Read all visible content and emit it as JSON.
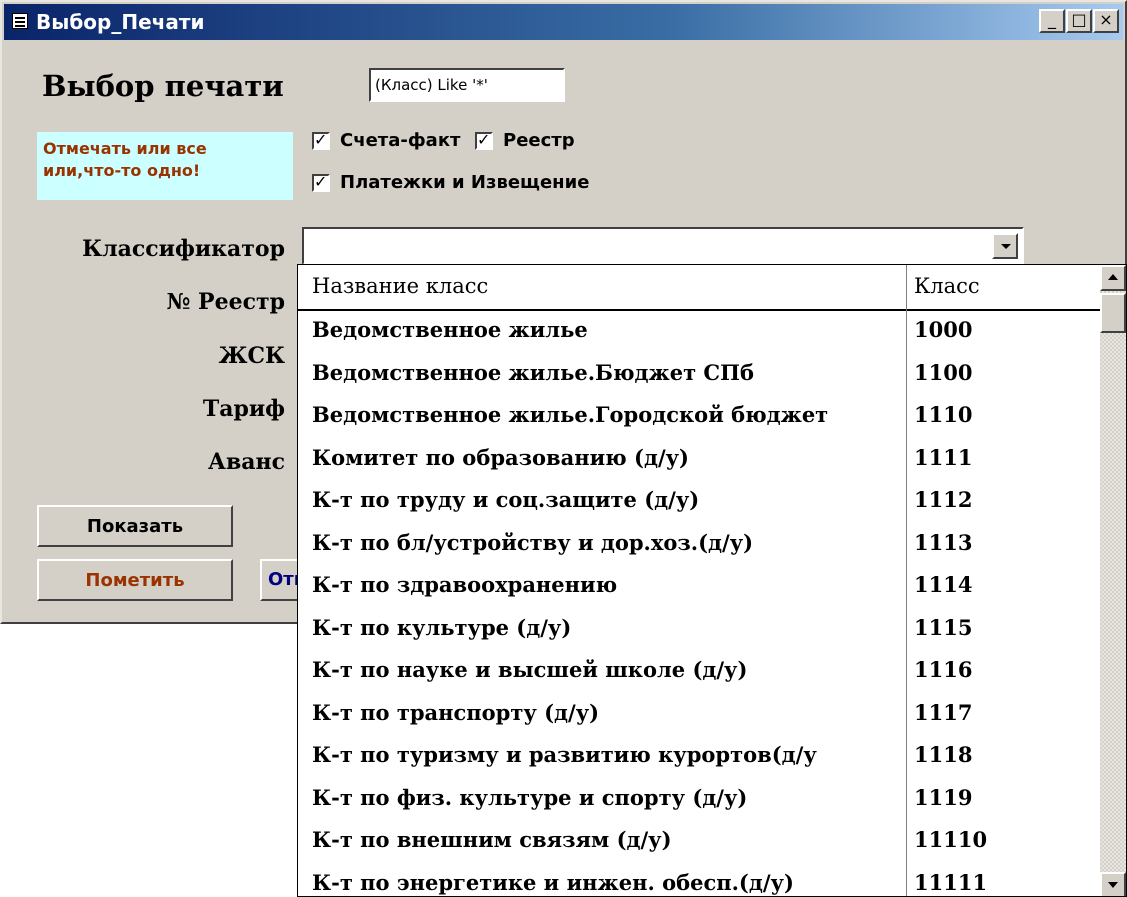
{
  "window": {
    "title": "Выбор_Печати",
    "minimize": "_",
    "maximize": "□",
    "close": "×"
  },
  "form": {
    "heading": "Выбор печати",
    "filter_value": "(Класс) Like '*'",
    "hint": "Отмечать или все или,что-то одно!",
    "checkboxes": [
      {
        "label": "Счета-факт",
        "checked": true
      },
      {
        "label": "Реестр",
        "checked": true
      },
      {
        "label": "Платежки и Извещение",
        "checked": true
      }
    ],
    "labels": {
      "classifier": "Классификатор",
      "registry_no": "№ Реестр",
      "zhsk": "ЖСК",
      "tariff": "Тариф",
      "advance": "Аванс"
    },
    "classifier_value": "",
    "buttons": {
      "show": "Показать",
      "mark": "Пометить",
      "partial": "Отм"
    },
    "colors": {
      "mark_button_text": "#993300",
      "partial_button_text": "#000080",
      "hint_bg": "#ccffff"
    }
  },
  "dropdown": {
    "headers": [
      "Название класс",
      "Класс"
    ],
    "rows": [
      {
        "name": "Ведомственное жилье",
        "code": "1000"
      },
      {
        "name": "Ведомственное жилье.Бюджет СПб",
        "code": "1100"
      },
      {
        "name": "Ведомственное жилье.Городской бюджет",
        "code": "1110"
      },
      {
        "name": "Комитет по образованию   (д/у)",
        "code": "1111"
      },
      {
        "name": "К-т по труду и соц.защите (д/у)",
        "code": "1112"
      },
      {
        "name": "К-т по бл/устройству и дор.хоз.(д/у)",
        "code": "1113"
      },
      {
        "name": "К-т по здравоохранению",
        "code": "1114"
      },
      {
        "name": "К-т по культуре (д/у)",
        "code": "1115"
      },
      {
        "name": "К-т по науке и высшей школе (д/у)",
        "code": "1116"
      },
      {
        "name": "К-т по транспорту (д/у)",
        "code": "1117"
      },
      {
        "name": "К-т по туризму и развитию курортов(д/у",
        "code": "1118"
      },
      {
        "name": "К-т по физ. культуре и спорту (д/у)",
        "code": "1119"
      },
      {
        "name": "К-т по внешним связям (д/у)",
        "code": "11110"
      },
      {
        "name": "К-т по энергетике и инжен. обесп.(д/у)",
        "code": "11111"
      }
    ]
  }
}
